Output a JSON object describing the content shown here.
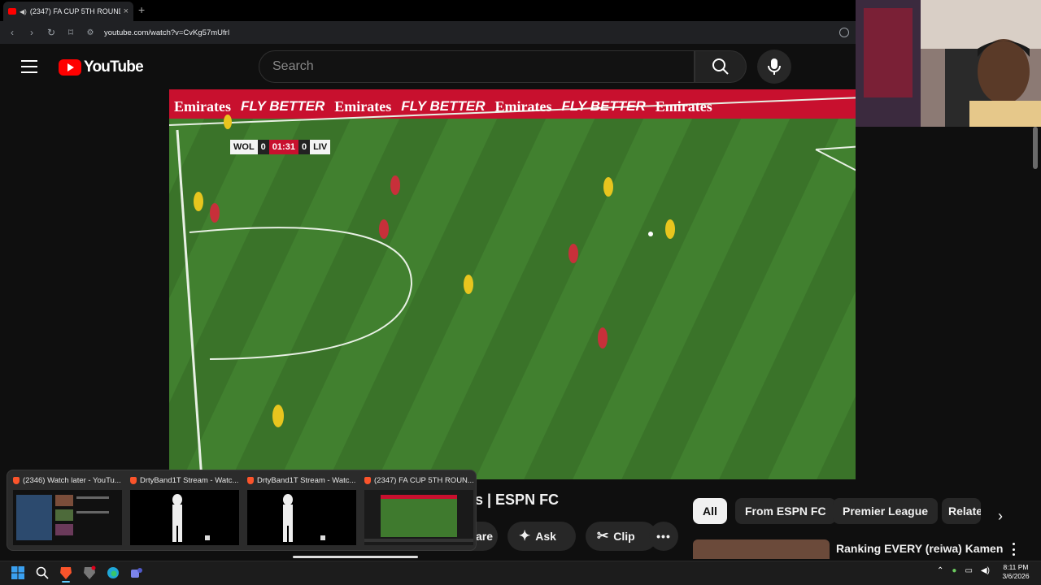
{
  "browser": {
    "tab_title": "(2347) FA CUP 5TH ROUND",
    "tab_close": "×",
    "new_tab": "+",
    "url": "youtube.com/watch?v=CvKg57mUfrI"
  },
  "youtube": {
    "logo_text": "YouTube",
    "search_placeholder": "Search"
  },
  "video": {
    "board_ads": [
      "Emirates",
      "FLY BETTER",
      "Emirates",
      "FLY BETTER",
      "Emirates",
      "FLY BETTER",
      "Emirates"
    ],
    "scorebug": {
      "home_team": "WOL",
      "home_score": "0",
      "time": "01:31",
      "away_score": "0",
      "away_team": "LIV"
    },
    "title_partial": "s | ESPN FC"
  },
  "actions": {
    "share": "are",
    "ask": "Ask",
    "clip": "Clip"
  },
  "chips": {
    "all": "All",
    "espn": "From ESPN FC",
    "premier_league": "Premier League",
    "related": "Relate"
  },
  "recommendation": {
    "title": "Ranking EVERY (reiwa) Kamen"
  },
  "previews": [
    {
      "title": "(2346) Watch later - YouTu..."
    },
    {
      "title": "DrtyBand1T Stream - Watc..."
    },
    {
      "title": "DrtyBand1T Stream - Watc..."
    },
    {
      "title": "(2347) FA CUP 5TH ROUN..."
    }
  ],
  "clock": {
    "time": "8:11 PM",
    "date": "3/6/2026"
  },
  "colors": {
    "youtube_red": "#ff0000",
    "pitch_green": "#3f7a2e",
    "board_red": "#c8102e"
  }
}
